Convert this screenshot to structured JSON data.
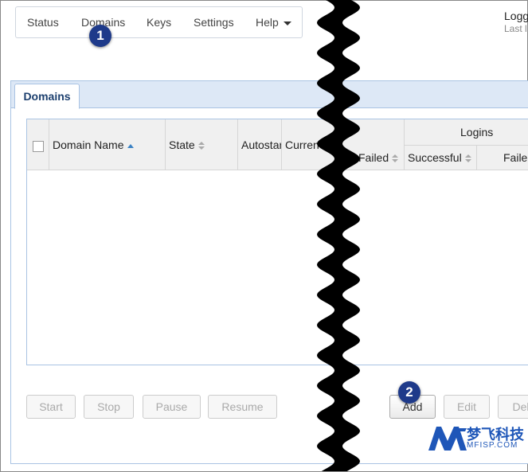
{
  "nav": {
    "items": [
      "Status",
      "Domains",
      "Keys",
      "Settings",
      "Help"
    ]
  },
  "user": {
    "line1": "Logg",
    "line2": "Last l"
  },
  "callouts": [
    "1",
    "2"
  ],
  "tabs": [
    {
      "label": "Domains"
    }
  ],
  "table": {
    "columns": {
      "domain_name": "Domain Name",
      "state": "State",
      "autostart": "Autostar",
      "current": "Curren",
      "failed": "Failed"
    },
    "group": {
      "label": "Logins",
      "sub": [
        "Successful",
        "Faile"
      ]
    }
  },
  "buttons": {
    "start": "Start",
    "stop": "Stop",
    "pause": "Pause",
    "resume": "Resume",
    "add": "Add",
    "edit": "Edit",
    "delete": "Del"
  },
  "watermark": {
    "cn": "梦飞科技",
    "en": "MFISP.COM"
  }
}
